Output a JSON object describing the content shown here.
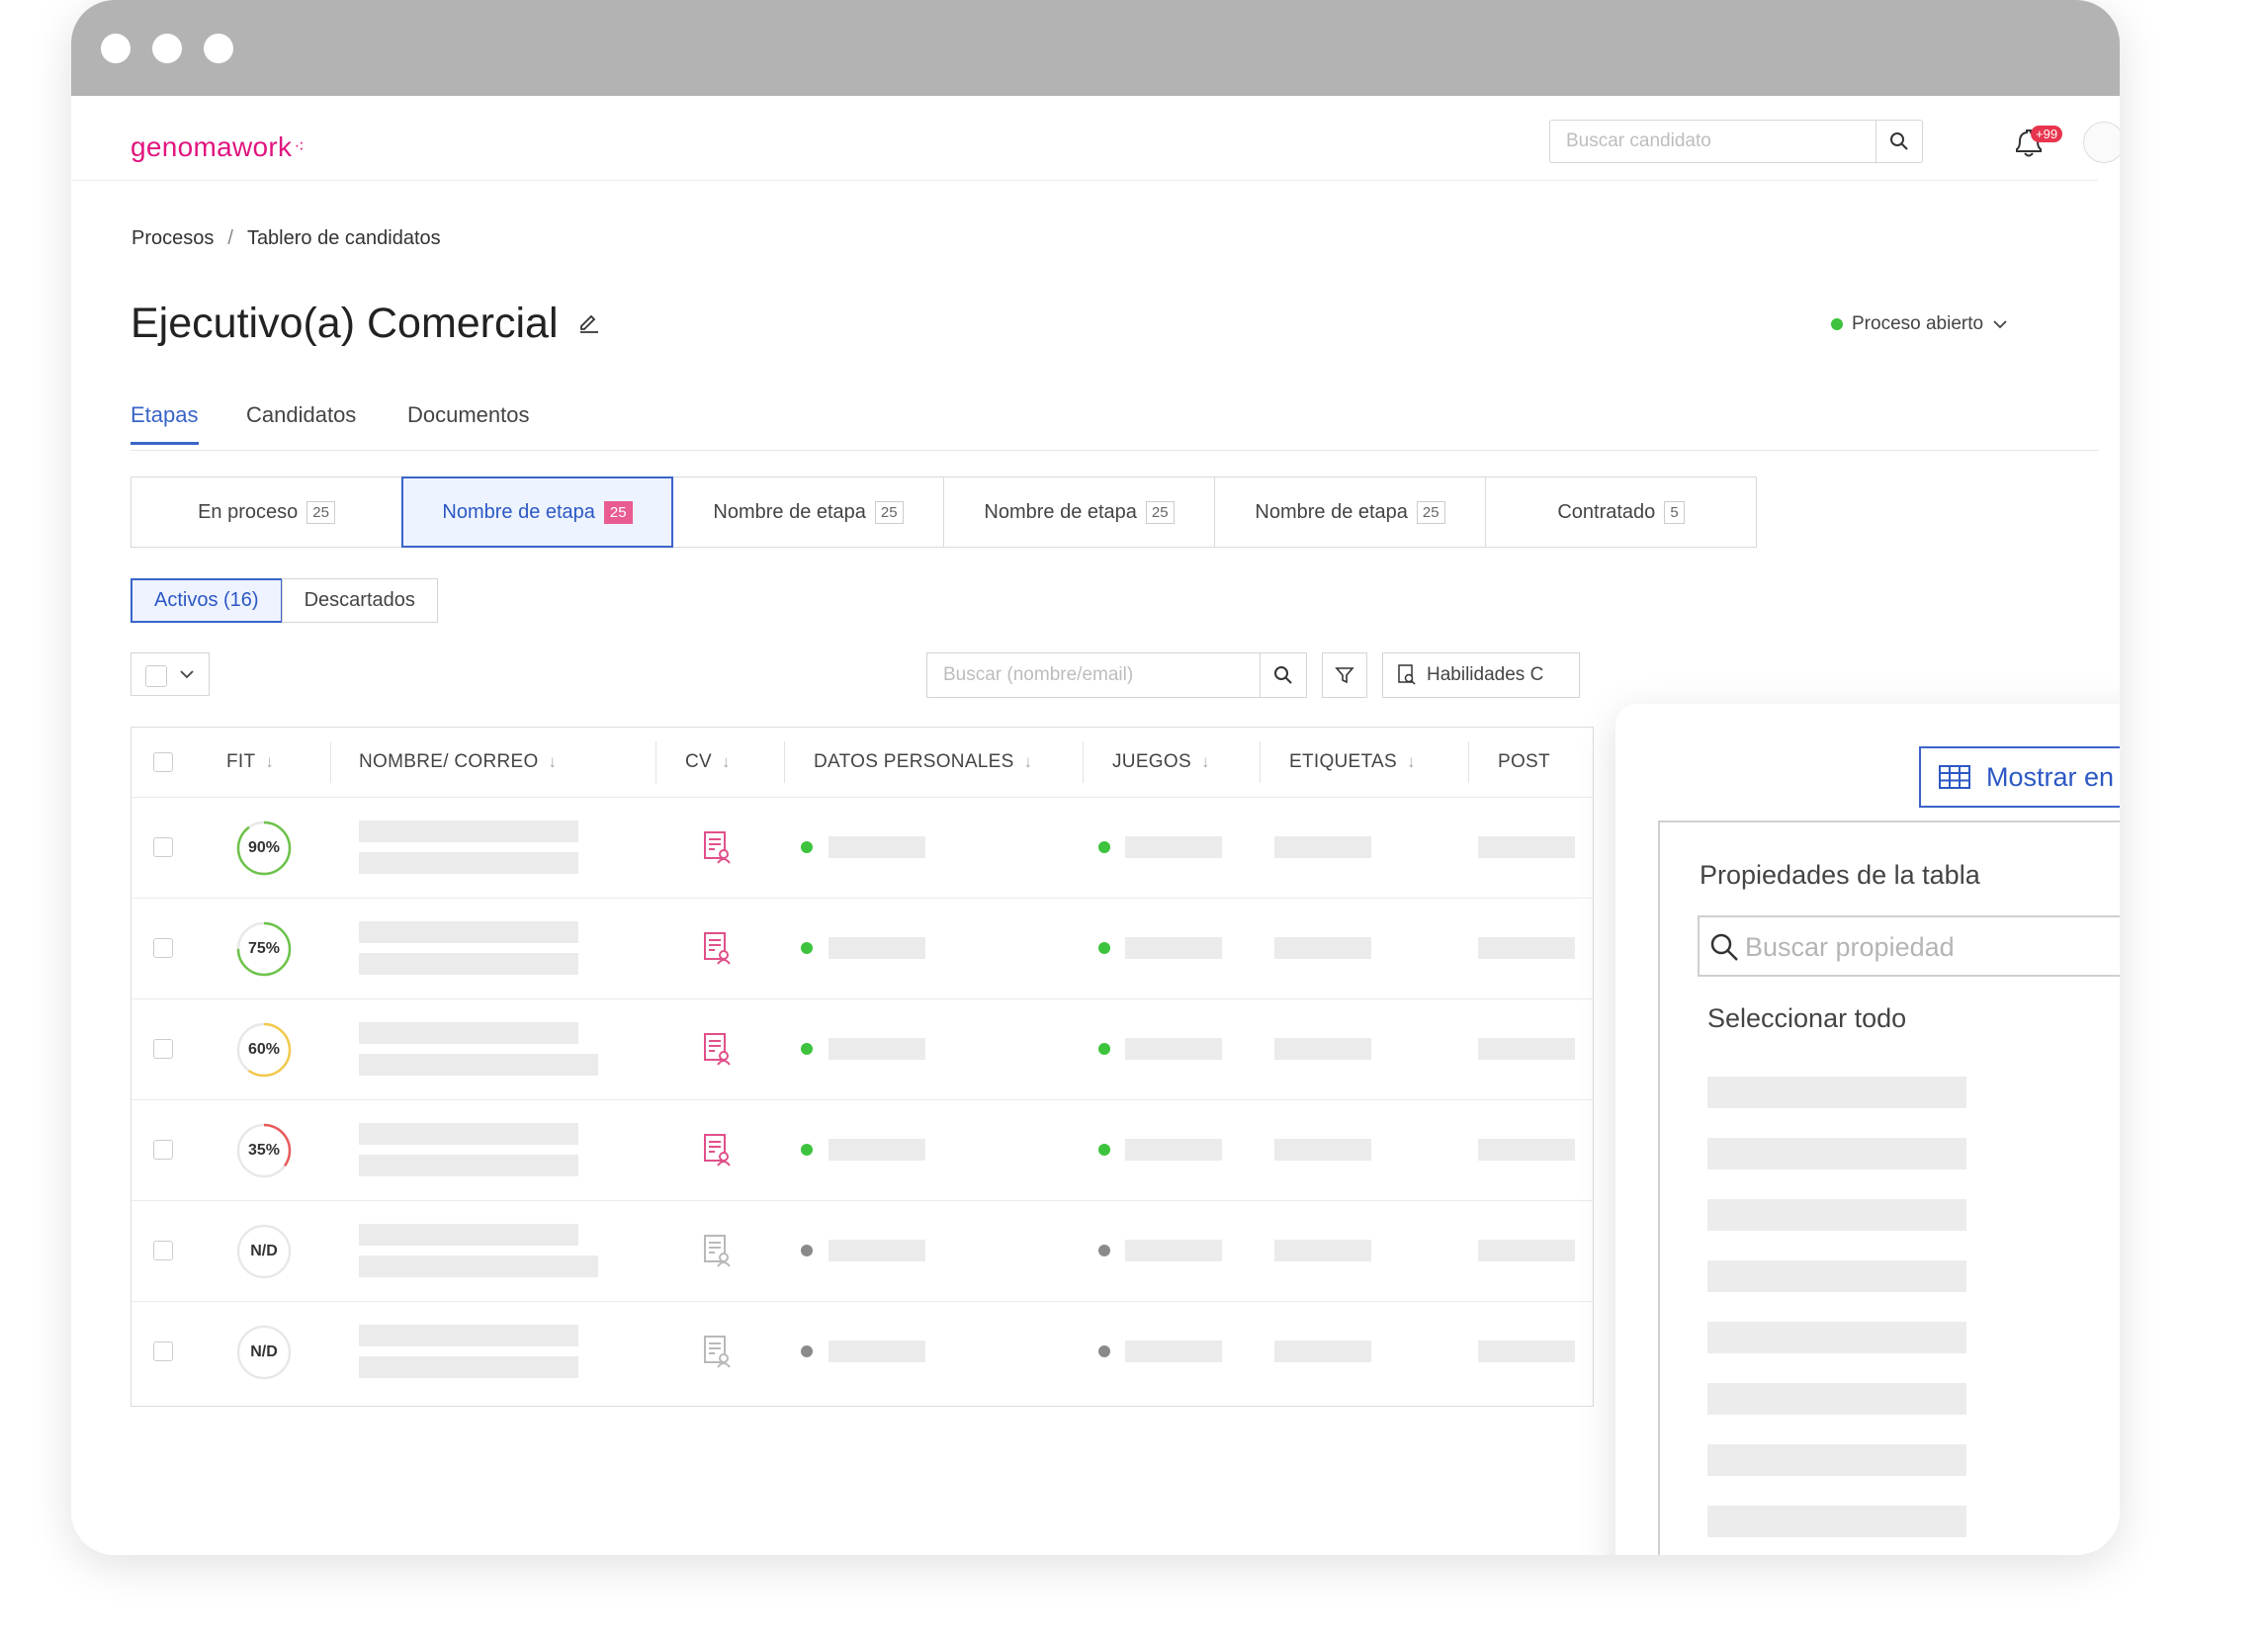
{
  "header": {
    "logo": "genomawork",
    "search_placeholder": "Buscar candidato",
    "notifications_badge": "+99"
  },
  "breadcrumb": {
    "items": [
      "Procesos",
      "Tablero de candidatos"
    ]
  },
  "page": {
    "title": "Ejecutivo(a) Comercial",
    "status": "Proceso abierto",
    "status_color": "#3dc33d"
  },
  "tabs": [
    {
      "label": "Etapas",
      "active": true
    },
    {
      "label": "Candidatos",
      "active": false
    },
    {
      "label": "Documentos",
      "active": false
    }
  ],
  "stages": [
    {
      "label": "En proceso",
      "count": "25"
    },
    {
      "label": "Nombre de etapa",
      "count": "25",
      "active": true
    },
    {
      "label": "Nombre de etapa",
      "count": "25"
    },
    {
      "label": "Nombre de etapa",
      "count": "25"
    },
    {
      "label": "Nombre de etapa",
      "count": "25"
    },
    {
      "label": "Contratado",
      "count": "5"
    }
  ],
  "segment": {
    "active": "Activos (16)",
    "inactive": "Descartados"
  },
  "toolbar": {
    "search_placeholder": "Buscar (nombre/email)",
    "skills_label": "Habilidades C"
  },
  "table": {
    "columns": [
      "FIT",
      "NOMBRE/ CORREO",
      "CV",
      "DATOS PERSONALES",
      "JUEGOS",
      "ETIQUETAS",
      "POST"
    ],
    "rows": [
      {
        "fit": "90%",
        "fit_value": 90,
        "ring_color": "#6cc24a",
        "cv_active": true,
        "status": "active"
      },
      {
        "fit": "75%",
        "fit_value": 75,
        "ring_color": "#6cc24a",
        "cv_active": true,
        "status": "active"
      },
      {
        "fit": "60%",
        "fit_value": 60,
        "ring_color": "#f2c94c",
        "cv_active": true,
        "status": "active"
      },
      {
        "fit": "35%",
        "fit_value": 35,
        "ring_color": "#e85a5a",
        "cv_active": true,
        "status": "active"
      },
      {
        "fit": "N/D",
        "fit_value": 0,
        "ring_color": "#e6e6e6",
        "cv_active": false,
        "status": "inactive"
      },
      {
        "fit": "N/D",
        "fit_value": 0,
        "ring_color": "#e6e6e6",
        "cv_active": false,
        "status": "inactive"
      }
    ]
  },
  "panel": {
    "button_label": "Mostrar en la tabla",
    "title": "Propiedades de la tabla",
    "search_placeholder": "Buscar propiedad",
    "select_all_label": "Seleccionar todo",
    "select_all_checked": false,
    "properties_checked": [
      true,
      true,
      true,
      true,
      true,
      false,
      true,
      false,
      true
    ]
  },
  "colors": {
    "accent": "#3a64c8",
    "brand": "#e0157f",
    "active_dot": "#3dc33d",
    "inactive_dot": "#8a8a8a",
    "cv_active": "#e0508a",
    "cv_inactive": "#b9b9b9"
  }
}
